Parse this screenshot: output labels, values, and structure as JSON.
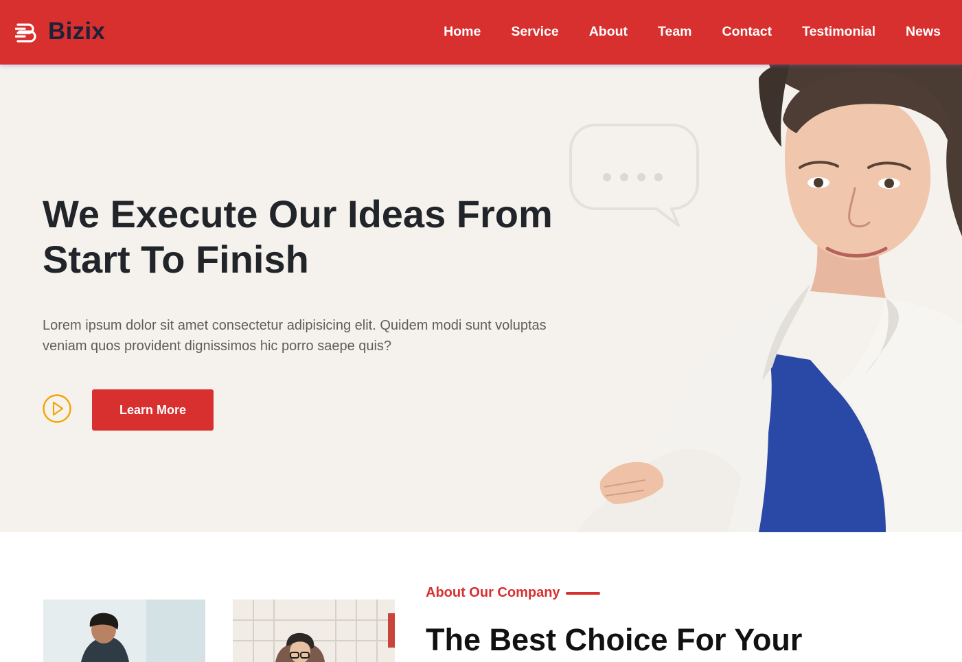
{
  "header": {
    "brand": "Bizix",
    "nav": [
      "Home",
      "Service",
      "About",
      "Team",
      "Contact",
      "Testimonial",
      "News"
    ]
  },
  "hero": {
    "title_line1": "We Execute Our Ideas From",
    "title_line2": "Start To Finish",
    "text": "Lorem ipsum dolor sit amet consectetur adipisicing elit. Quidem modi sunt voluptas veniam quos provident dignissimos hic porro saepe quis?",
    "cta_label": "Learn More"
  },
  "about": {
    "label": "About Our Company",
    "title": "The Best Choice For Your"
  },
  "colors": {
    "primary": "#d82f2f",
    "hero_bg": "#f5f2ee",
    "play_accent": "#f0a500",
    "dark_text": "#212529"
  },
  "icons": {
    "logo": "logo-b-icon",
    "play": "play-circle-icon",
    "bubble": "speech-bubble-icon"
  }
}
